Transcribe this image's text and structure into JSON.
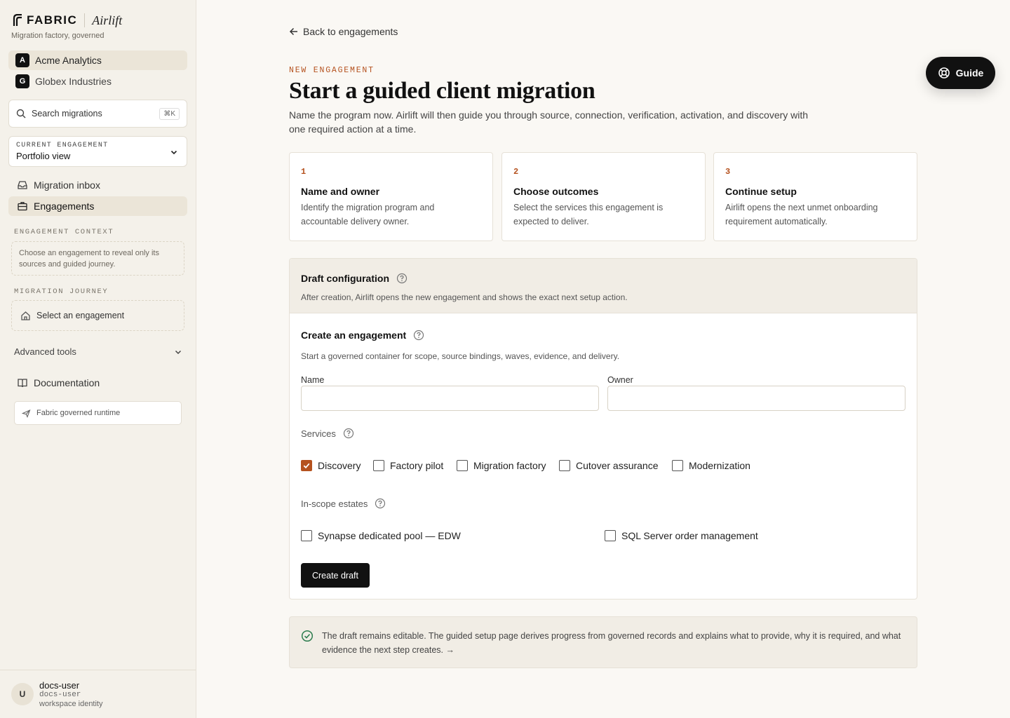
{
  "brand": {
    "name": "FABRIC",
    "product": "Airlift",
    "tagline": "Migration factory, governed"
  },
  "orgs": [
    {
      "badge": "A",
      "name": "Acme Analytics",
      "active": true
    },
    {
      "badge": "G",
      "name": "Globex Industries",
      "active": false
    }
  ],
  "search": {
    "placeholder": "Search migrations",
    "shortcut": "⌘K"
  },
  "engagement_selector": {
    "label": "CURRENT ENGAGEMENT",
    "value": "Portfolio view"
  },
  "nav": [
    {
      "label": "Migration inbox",
      "icon": "inbox-icon",
      "active": false
    },
    {
      "label": "Engagements",
      "icon": "briefcase-icon",
      "active": true
    }
  ],
  "engagement_context": {
    "label": "ENGAGEMENT CONTEXT",
    "text": "Choose an engagement to reveal only its sources and guided journey."
  },
  "migration_journey": {
    "label": "MIGRATION JOURNEY",
    "item": "Select an engagement"
  },
  "advanced_tools": "Advanced tools",
  "documentation": "Documentation",
  "runtime": "Fabric governed runtime",
  "user": {
    "avatar": "U",
    "name": "docs-user",
    "id": "docs-user",
    "role": "workspace identity"
  },
  "header": {
    "back_label": "Back to engagements",
    "eyebrow": "NEW ENGAGEMENT",
    "title": "Start a guided client migration",
    "subtitle": "Name the program now. Airlift will then guide you through source, connection, verification, activation, and discovery with one required action at a time."
  },
  "guide_button": "Guide",
  "steps": [
    {
      "num": "1",
      "title": "Name and owner",
      "desc": "Identify the migration program and accountable delivery owner."
    },
    {
      "num": "2",
      "title": "Choose outcomes",
      "desc": "Select the services this engagement is expected to deliver."
    },
    {
      "num": "3",
      "title": "Continue setup",
      "desc": "Airlift opens the next unmet onboarding requirement automatically."
    }
  ],
  "draft": {
    "title": "Draft configuration",
    "desc": "After creation, Airlift opens the new engagement and shows the exact next setup action."
  },
  "form": {
    "title": "Create an engagement",
    "desc": "Start a governed container for scope, source bindings, waves, evidence, and delivery.",
    "name_label": "Name",
    "name_value": "",
    "owner_label": "Owner",
    "owner_value": "",
    "services_label": "Services",
    "services": [
      {
        "label": "Discovery",
        "checked": true
      },
      {
        "label": "Factory pilot",
        "checked": false
      },
      {
        "label": "Migration factory",
        "checked": false
      },
      {
        "label": "Cutover assurance",
        "checked": false
      },
      {
        "label": "Modernization",
        "checked": false
      }
    ],
    "estates_label": "In-scope estates",
    "estates": [
      {
        "label": "Synapse dedicated pool — EDW",
        "checked": false
      },
      {
        "label": "SQL Server order management",
        "checked": false
      }
    ],
    "submit": "Create draft"
  },
  "footer_note": "The draft remains editable. The guided setup page derives progress from governed records and explains what to provide, why it is required, and what evidence the next step creates. →",
  "colors": {
    "accent": "#b5521f",
    "sidebar_bg": "#f4f1ea",
    "page_bg": "#faf8f4",
    "primary_button": "#111111"
  }
}
